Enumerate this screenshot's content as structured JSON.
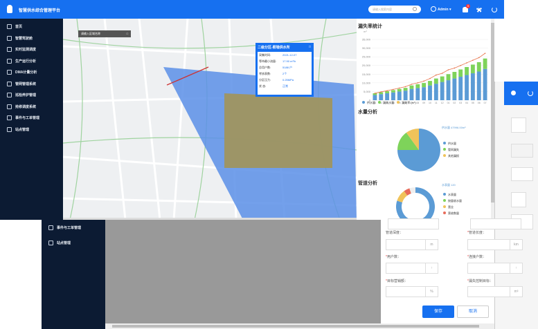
{
  "app": {
    "title": "智慧供水综合管理平台",
    "search_placeholder": "请输入搜索内容",
    "user": "Admin",
    "notify_count": "9"
  },
  "menu": [
    {
      "label": "首页",
      "icon": "home-icon"
    },
    {
      "label": "智慧驾驶舱",
      "icon": "dashboard-icon"
    },
    {
      "label": "实时监测调度",
      "icon": "monitor-icon"
    },
    {
      "label": "生产运行分析",
      "icon": "bar-chart-icon"
    },
    {
      "label": "DMA计量分析",
      "icon": "meter-icon"
    },
    {
      "label": "管网管理系统",
      "icon": "pipe-icon"
    },
    {
      "label": "巡检养护管理",
      "icon": "person-icon"
    },
    {
      "label": "抢修调度系统",
      "icon": "wrench-icon"
    },
    {
      "label": "事件与工单管理",
      "icon": "ticket-icon"
    },
    {
      "label": "站点管理",
      "icon": "station-icon"
    }
  ],
  "map": {
    "import_label": "请输入区域名称",
    "popup": {
      "title": "二级分区-照墙供水所",
      "rows": [
        [
          "采集时间:",
          "2021-12-07"
        ],
        [
          "等待最小流量:",
          "17.90 m³/h"
        ],
        [
          "总用户数:",
          "5188 户"
        ],
        [
          "考核表数:",
          "2个"
        ],
        [
          "分区压力:",
          "0.25MPa"
        ],
        [
          "状 态:",
          "正常"
        ]
      ]
    }
  },
  "right": {
    "leak_title": "漏失率统计",
    "unit": "m³",
    "y_ticks": [
      "35,000",
      "30,000",
      "25,000",
      "20,000",
      "15,000",
      "10,000",
      "5,000",
      "0"
    ],
    "legend": [
      "供水量",
      "漏失水量",
      "漏失率 (m³)"
    ],
    "water_title": "水量分析",
    "water_note": "供水量 47996.00m³",
    "water_legend": [
      "供水量",
      "管网漏失",
      "其他漏损"
    ],
    "pipe_title": "管道分析",
    "pipe_note": "水表量 120",
    "pipe_legend": [
      "水表量",
      "按量收水量",
      "营业",
      "营收数量"
    ]
  },
  "lower_menu": [
    {
      "label": "事件与工单管理",
      "icon": "ticket-icon"
    },
    {
      "label": "站点管理",
      "icon": "station-icon"
    }
  ],
  "form": {
    "pipe_depth": "管道深度：",
    "pipe_length": "管道长度：",
    "users": "用户数：",
    "connections": "连接户数：",
    "target": "目标营销额：",
    "leak_target": "漏失控制目标：",
    "unit_m": "m",
    "unit_km": "km",
    "unit_pct": "%",
    "unit_m3": "m³",
    "save": "保存",
    "cancel": "取消"
  },
  "chart_data": {
    "type": "bar",
    "categories": [
      "01",
      "02",
      "03",
      "04",
      "05",
      "06",
      "07",
      "08",
      "09",
      "10",
      "11",
      "12",
      "01",
      "02",
      "03",
      "04",
      "05",
      "06",
      "07"
    ],
    "series": [
      {
        "name": "供水量",
        "values": [
          3000,
          3500,
          4000,
          4500,
          5000,
          5500,
          6500,
          7000,
          7500,
          8500,
          9500,
          10500,
          11500,
          12500,
          13500,
          14500,
          15500,
          16500,
          18000
        ]
      },
      {
        "name": "漏失水量",
        "values": [
          1000,
          1100,
          1200,
          1300,
          1500,
          1600,
          2000,
          2200,
          2400,
          2600,
          3000,
          3200,
          3500,
          3800,
          4200,
          4600,
          5000,
          5400,
          6000
        ]
      },
      {
        "name": "漏失率 (m³)",
        "values": [
          4000,
          4800,
          5500,
          6200,
          7000,
          7800,
          9200,
          10000,
          11000,
          12500,
          14500,
          15500,
          17500,
          18500,
          20000,
          21500,
          23000,
          24500,
          27000
        ]
      }
    ],
    "ylim": [
      0,
      35000
    ],
    "colors": [
      "#5b9bd5",
      "#7ed35a",
      "#f0c35a"
    ]
  },
  "pie1": {
    "values": [
      75,
      15,
      10
    ],
    "colors": [
      "#5b9bd5",
      "#7ed35a",
      "#f0c35a"
    ]
  },
  "pie2": {
    "values": [
      80,
      10,
      5,
      5
    ],
    "colors": [
      "#5b9bd5",
      "#f0c35a",
      "#e86b5a",
      "#eeeeee"
    ]
  }
}
